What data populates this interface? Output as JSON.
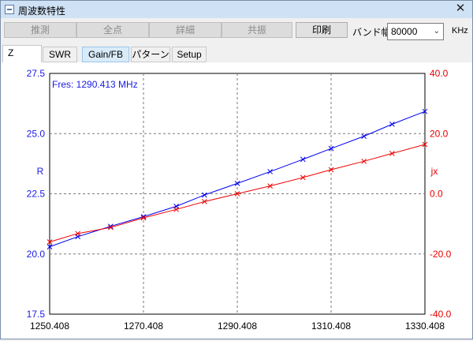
{
  "window": {
    "title": "周波数特性",
    "close_glyph": "✕"
  },
  "toolbar": {
    "buttons": [
      {
        "label": "推測",
        "enabled": false
      },
      {
        "label": "全点",
        "enabled": false
      },
      {
        "label": "詳細",
        "enabled": false
      },
      {
        "label": "共振",
        "enabled": false
      },
      {
        "label": "印刷",
        "enabled": true
      }
    ],
    "band_label": "バンド幅",
    "band_value": "80000",
    "unit": "KHz"
  },
  "tabs": {
    "z": "Z",
    "items": [
      {
        "label": "SWR",
        "active": false
      },
      {
        "label": "Gain/FB",
        "active": true
      },
      {
        "label": "パターン",
        "active": false
      },
      {
        "label": "Setup",
        "active": false
      }
    ]
  },
  "colors": {
    "r_series": "#0000ee",
    "jx_series": "#ee0000",
    "grid": "#7a7a7a"
  },
  "chart_data": {
    "type": "line",
    "annotation": "Fres: 1290.413 MHz",
    "xlim": [
      1250.408,
      1330.408
    ],
    "x_ticks": [
      "1250.408",
      "1270.408",
      "1290.408",
      "1310.408",
      "1330.408"
    ],
    "y_left": {
      "label": "R",
      "lim": [
        17.5,
        27.5
      ],
      "ticks": [
        "17.5",
        "20.0",
        "22.5",
        "25.0",
        "27.5"
      ]
    },
    "y_right": {
      "label": "jx",
      "lim": [
        -40.0,
        40.0
      ],
      "ticks": [
        "-40.0",
        "-20.0",
        "0.0",
        "20.0",
        "40.0"
      ]
    },
    "grid": true,
    "series": [
      {
        "axis": "left",
        "color": "#0000ee",
        "x": [
          1250.408,
          1256.408,
          1263.408,
          1270.408,
          1277.408,
          1283.408,
          1290.408,
          1297.408,
          1304.408,
          1310.408,
          1317.408,
          1323.408,
          1330.408
        ],
        "y": [
          20.3,
          20.72,
          21.15,
          21.55,
          21.98,
          22.45,
          22.93,
          23.42,
          23.93,
          24.38,
          24.89,
          25.39,
          25.92
        ]
      },
      {
        "axis": "right",
        "color": "#ee0000",
        "x": [
          1250.408,
          1256.408,
          1263.408,
          1270.408,
          1277.408,
          1283.408,
          1290.408,
          1297.408,
          1304.408,
          1310.408,
          1317.408,
          1323.408,
          1330.408
        ],
        "y": [
          -16.0,
          -13.2,
          -11.2,
          -8.0,
          -5.2,
          -2.6,
          0.0,
          2.6,
          5.4,
          8.0,
          10.8,
          13.4,
          16.4
        ]
      }
    ]
  }
}
